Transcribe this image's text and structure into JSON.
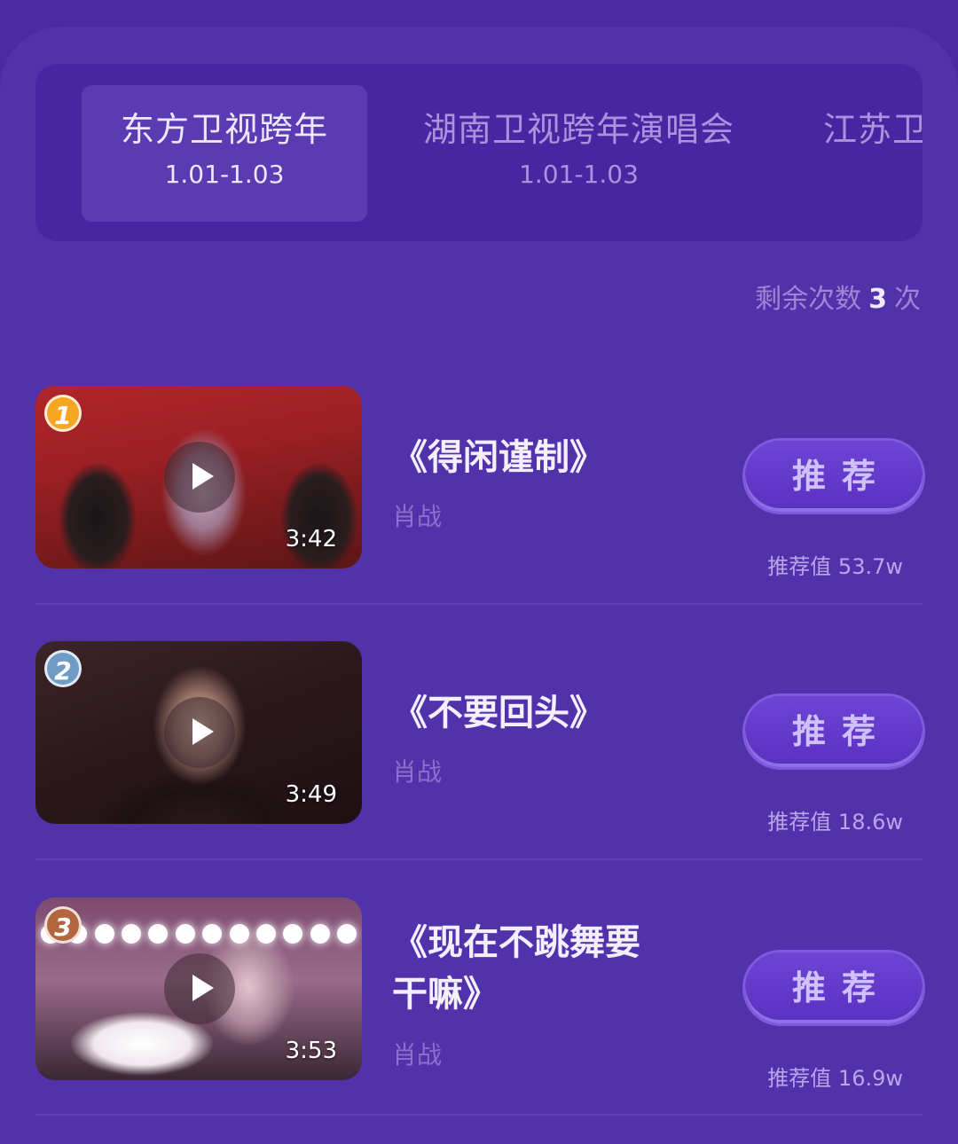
{
  "tabs": [
    {
      "title": "东方卫视跨年",
      "date": "1.01-1.03",
      "active": true
    },
    {
      "title": "湖南卫视跨年演唱会",
      "date": "1.01-1.03",
      "active": false
    },
    {
      "title": "江苏卫",
      "date": "",
      "active": false
    }
  ],
  "remaining": {
    "label": "剩余次数",
    "count": "3",
    "unit": "次"
  },
  "items": [
    {
      "rank": "1",
      "duration": "3:42",
      "title": "《得闲谨制》",
      "artist": "肖战",
      "button": "推荐",
      "rec_value": "推荐值  53.7w"
    },
    {
      "rank": "2",
      "duration": "3:49",
      "title": "《不要回头》",
      "artist": "肖战",
      "button": "推荐",
      "rec_value": "推荐值  18.6w"
    },
    {
      "rank": "3",
      "duration": "3:53",
      "title": "《现在不跳舞要\n干嘛》",
      "artist": "肖战",
      "button": "推荐",
      "rec_value": "推荐值  16.9w"
    }
  ]
}
